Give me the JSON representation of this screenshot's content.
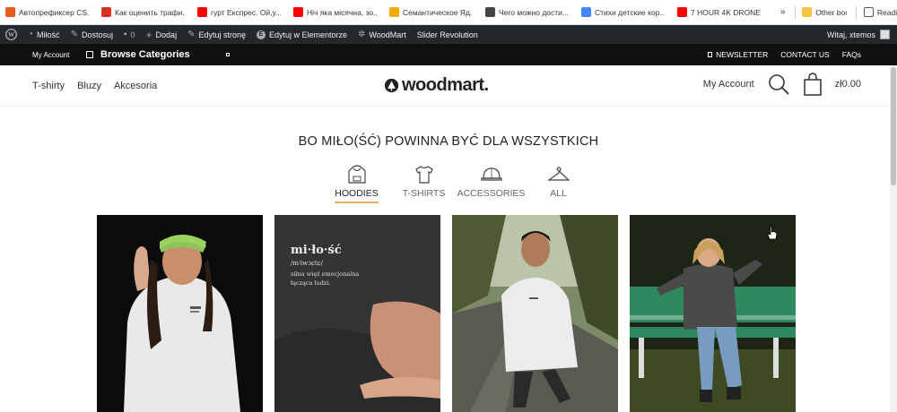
{
  "bookmarks": {
    "items": [
      {
        "label": "Автопрефиксер CS...",
        "color": "#e85a1e"
      },
      {
        "label": "Как оценить трафи...",
        "color": "#d93025"
      },
      {
        "label": "гурт Експрес. Ой,у...",
        "color": "#ff0000"
      },
      {
        "label": "Ніч яка місячна, зо...",
        "color": "#ff0000"
      },
      {
        "label": "Семантическое Яд...",
        "color": "#f2a900"
      },
      {
        "label": "Чего можно дости...",
        "color": "#444444"
      },
      {
        "label": "Стихи детские кор...",
        "color": "#4285f4"
      },
      {
        "label": "7 HOUR 4K DRONE...",
        "color": "#ff0000"
      }
    ],
    "more": "»",
    "other": "Other bookmarks",
    "reading": "Reading list"
  },
  "adminbar": {
    "wp_icon": "wordpress-icon",
    "site": "Miłość",
    "customize": "Dostosuj",
    "comments_count": "0",
    "add": "Dodaj",
    "edit_page": "Edytuj stronę",
    "edit_elementor": "Edytuj w Elementorze",
    "woodmart": "WoodMart",
    "slider": "Slider Revolution",
    "greeting": "Witaj, xtemos"
  },
  "topbar": {
    "my_account": "My Account",
    "browse": "Browse Categories",
    "newsletter": "NEWSLETTER",
    "contact": "CONTACT US",
    "faqs": "FAQs"
  },
  "header": {
    "nav": [
      "T-shirty",
      "Bluzy",
      "Akcesoria"
    ],
    "logo": "woodmart.",
    "account": "My Account",
    "cart_total": "zł0.00"
  },
  "headline": "BO MIŁO(ŚĆ) POWINNA BYĆ DLA WSZYSTKICH",
  "categories": [
    {
      "label": "HOODIES",
      "icon": "hoodie-icon",
      "active": true
    },
    {
      "label": "T-SHIRTS",
      "icon": "tshirt-icon",
      "active": false
    },
    {
      "label": "ACCESSORIES",
      "icon": "cap-icon",
      "active": false
    },
    {
      "label": "ALL",
      "icon": "hanger-icon",
      "active": false
    }
  ],
  "products": [
    {
      "name": "girl-white-hoodie-green-cap"
    },
    {
      "name": "dark-sweatshirt-print-closeup",
      "print": {
        "word": "mi·ło·ść",
        "phonetic": "/mʲiwɔɕtɕ/",
        "line1": "silna więź emocjonalna",
        "line2": "łącząca ludzi."
      }
    },
    {
      "name": "guy-white-hoodie-park"
    },
    {
      "name": "girl-dark-hoodie-bench"
    }
  ],
  "colors": {
    "adminbar": "#23282d",
    "topbar": "#111111",
    "accent_underline": "#e0b15a"
  }
}
